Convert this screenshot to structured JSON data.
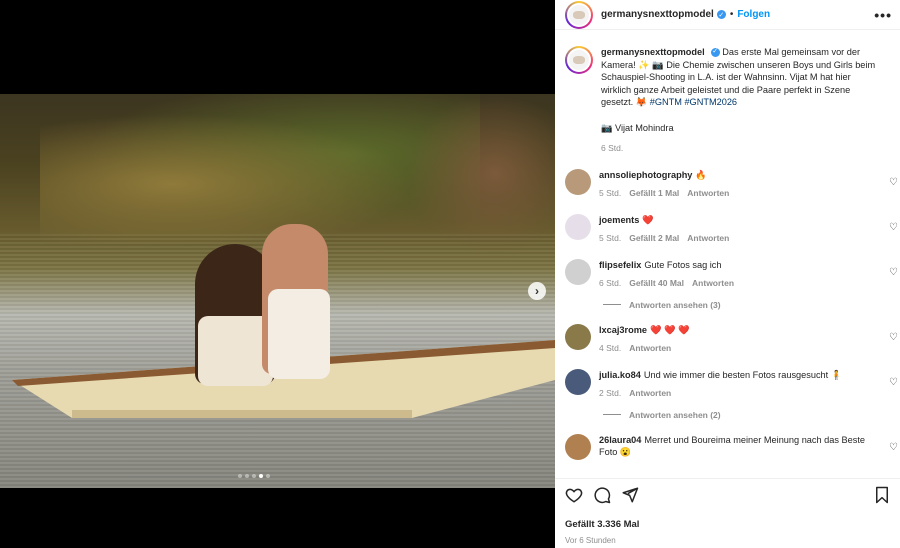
{
  "header": {
    "username": "germanysnexttopmodel",
    "separator": "•",
    "follow_label": "Folgen",
    "more_label": "•••"
  },
  "caption": {
    "username": "germanysnexttopmodel",
    "text": "Das erste Mal gemeinsam vor der Kamera! ✨ 📷 Die Chemie zwischen unseren Boys und Girls beim Schauspiel-Shooting in L.A. ist der Wahnsinn. Vijat M hat hier wirklich ganze Arbeit geleistet und die Paare perfekt in Szene gesetzt. 🦊",
    "hashtags": "#GNTM #GNTM2026",
    "credit": "📷 Vijat Mohindra",
    "time": "6 Std."
  },
  "comments": [
    {
      "username": "annsoliephotography",
      "text": "🔥",
      "time": "5 Std.",
      "likes": "Gefällt 1 Mal",
      "reply": "Antworten",
      "avatar_color": "#b89a7a"
    },
    {
      "username": "joements",
      "text": "❤️",
      "time": "5 Std.",
      "likes": "Gefällt 2 Mal",
      "reply": "Antworten",
      "avatar_color": "#e6dfe9"
    },
    {
      "username": "flipsefelix",
      "text": "Gute Fotos sag ich",
      "time": "6 Std.",
      "likes": "Gefällt 40 Mal",
      "reply": "Antworten",
      "avatar_color": "#d0d0d0",
      "view_replies": "Antworten ansehen (3)"
    },
    {
      "username": "lxcaj3rome",
      "text": "❤️ ❤️ ❤️",
      "time": "4 Std.",
      "likes": "",
      "reply": "Antworten",
      "avatar_color": "#8a7a4a"
    },
    {
      "username": "julia.ko84",
      "text": "Und wie immer die besten Fotos rausgesucht 🧍",
      "time": "2 Std.",
      "likes": "",
      "reply": "Antworten",
      "avatar_color": "#4a5a7a",
      "view_replies": "Antworten ansehen (2)"
    },
    {
      "username": "26laura04",
      "text": "Merret und Boureima meiner Meinung nach das Beste Foto 😮",
      "time": "",
      "likes": "",
      "reply": "",
      "avatar_color": "#b08050"
    }
  ],
  "footer": {
    "likes": "Gefällt 3.336 Mal",
    "time": "Vor 6 Stunden"
  },
  "icons": {
    "like": "heart-icon",
    "comment": "comment-icon",
    "share": "share-icon",
    "save": "bookmark-icon",
    "next": "chevron-right-icon"
  },
  "media": {
    "slides_total": 5,
    "slide_active": 3
  },
  "colors": {
    "accent": "#0095f6",
    "heart": "#ed4956",
    "hashtag": "#00376b"
  }
}
